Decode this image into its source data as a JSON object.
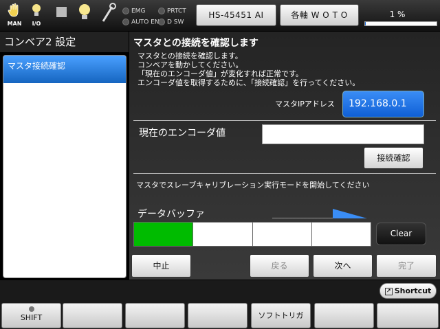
{
  "topbar": {
    "icons": [
      {
        "name": "hand-icon",
        "label": "MAN"
      },
      {
        "name": "bulb-icon",
        "label": "I/O"
      },
      {
        "name": "stop-icon",
        "label": ""
      },
      {
        "name": "lamp-icon",
        "label": ""
      },
      {
        "name": "wrench-icon",
        "label": ""
      }
    ],
    "lamps": [
      "EMG",
      "PRTCT",
      "AUTO EN",
      "D SW"
    ],
    "model_button": "HS-45451 AI",
    "axis_button": "各軸 W O T O",
    "speed_percent": "1 %",
    "speed_value": 1
  },
  "left": {
    "title": "コンベア2 設定",
    "items": [
      {
        "label": "マスタ接続確認"
      }
    ]
  },
  "main": {
    "heading": "マスタとの接続を確認します",
    "instructions": [
      "マスタとの接続を確認します。",
      "コンベアを動かしてください。",
      "「現在のエンコーダ値」が変化すれば正常です。",
      "エンコーダ値を取得するために、「接続確認」を行ってください。"
    ],
    "ip_label": "マスタIPアドレス",
    "ip_value": "192.168.0.1",
    "encoder_label": "現在のエンコーダ値",
    "encoder_value": "",
    "connect_button": "接続確認",
    "slave_msg": "マスタでスレーブキャリブレーション実行モードを開始してください",
    "buffer_label": "データバッファ",
    "buffer_cells": [
      true,
      false,
      false,
      false
    ],
    "clear_button": "Clear",
    "nav": {
      "stop": "中止",
      "back": "戻る",
      "next": "次へ",
      "done": "完了"
    }
  },
  "bottom": {
    "shortcut": "Shortcut",
    "fkeys": [
      "SHIFT",
      "",
      "",
      "",
      "ソフトトリガ",
      "",
      ""
    ]
  },
  "colors": {
    "accent": "#1e6fe0",
    "buffer_on": "#00bb00"
  }
}
